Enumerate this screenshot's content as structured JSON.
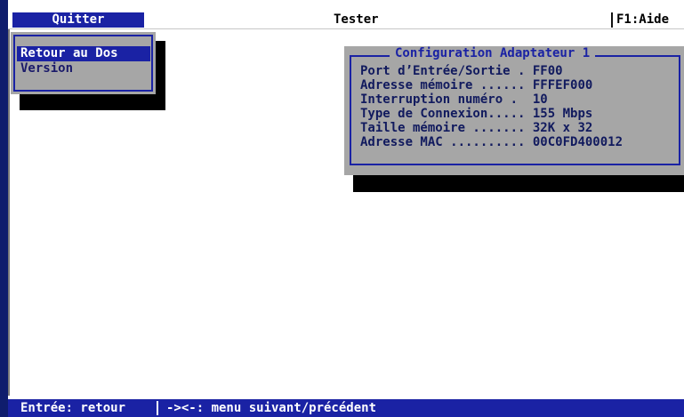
{
  "menubar": {
    "quitter": "Quitter",
    "tester": "Tester",
    "help": "F1:Aide"
  },
  "dropdown": {
    "items": [
      {
        "label": "Retour au Dos",
        "selected": true
      },
      {
        "label": "Version",
        "selected": false
      }
    ]
  },
  "config": {
    "title": "Configuration Adaptateur 1",
    "rows": [
      {
        "label": "Port d’Entrée/Sortie . ",
        "value": "FF00"
      },
      {
        "label": "Adresse mémoire ...... ",
        "value": "FFFEF000"
      },
      {
        "label": "Interruption numéro .  ",
        "value": "10"
      },
      {
        "label": "Type de Connexion..... ",
        "value": "155 Mbps"
      },
      {
        "label": "Taille mémoire ....... ",
        "value": "32K x 32"
      },
      {
        "label": "Adresse MAC .......... ",
        "value": "00C0FD400012"
      }
    ]
  },
  "statusbar": {
    "left": "Entrée: retour",
    "right": "-><-: menu suivant/précédent"
  },
  "colors": {
    "menu_blue": "#1a22a4",
    "panel_gray": "#a6a6a6",
    "border_navy": "#0f1d6d"
  }
}
